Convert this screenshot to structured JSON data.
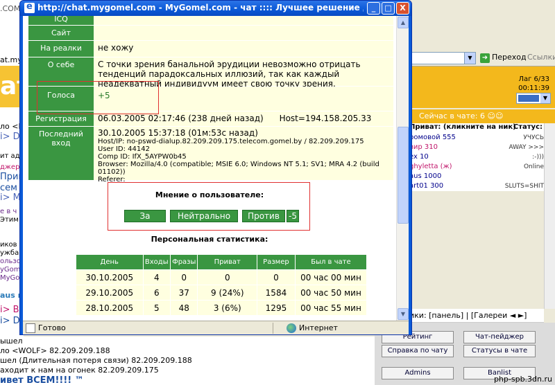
{
  "window": {
    "title": "http://chat.mygomel.com - MyGomel.com - чат :::: Лучшее решение для вашего об...",
    "minimize": "_",
    "maximize": "□",
    "close": "X"
  },
  "profile": {
    "rows": [
      {
        "label": "ICQ",
        "value": ""
      },
      {
        "label": "Сайт",
        "value": ""
      },
      {
        "label": "На реалки",
        "value": "не хожу"
      },
      {
        "label": "О себе",
        "value": "С точки зрения банальной эрудиции невозможно отрицать тенденций парадоксальных иллюзий, так как каждый неадекватный индивидуум имеет свою точку зрения."
      },
      {
        "label": "Голоса",
        "value": "+5"
      },
      {
        "label": "Регистрация",
        "value": "06.03.2005 02:17:46 (238 дней назад)      Host=194.158.205.33"
      }
    ],
    "last_login": {
      "label": "Последний вход",
      "datetime": "30.10.2005 15:37:18 (01м:53с назад)",
      "host": "Host/IP:  no-pswd-dialup.82.209.209.175.telecom.gomel.by / 82.209.209.175",
      "user_id": "User ID:  44142",
      "comp_id": "Comp ID: IfX_5AYPW0b45",
      "browser": "Browser:  Mozilla/4.0 (compatible; MSIE 6.0; Windows NT 5.1; SV1; MRA 4.2 (build 01102))",
      "referer": "Referer:"
    }
  },
  "opinion": {
    "title": "Мнение о пользователе:",
    "for_label": "За",
    "neutral_label": "Нейтрально",
    "against_label": "Против",
    "score": "-5"
  },
  "stats": {
    "title": "Персональная статистика:",
    "headers": [
      "День",
      "Входы",
      "Фразы",
      "Приват",
      "Размер",
      "Был в чате"
    ],
    "rows": [
      [
        "30.10.2005",
        "4",
        "0",
        "0",
        "0",
        "00 час 00 мин"
      ],
      [
        "29.10.2005",
        "6",
        "37",
        "9 (24%)",
        "1584",
        "00 час 50 мин"
      ],
      [
        "28.10.2005",
        "5",
        "48",
        "3 (6%)",
        "1295",
        "00 час 55 мин"
      ]
    ]
  },
  "statusbar": {
    "text": "Готово",
    "zone": "Интернет"
  },
  "background": {
    "go_label": "Переход",
    "links_label": "Ссылки",
    "lag": "Лаг 6/33",
    "time": "00:11:39",
    "online": "Сейчас в чате: 6",
    "private_header": "Приват: (кликните на ник)",
    "status_header": "Статус:",
    "users": [
      {
        "name": "ромовой 555",
        "status": "УЧУСЬ"
      },
      {
        "name": "вир 310",
        "status": "AWAY >>>"
      },
      {
        "name": "ex 10",
        "status": ":-)))"
      },
      {
        "name": "ghyletta (ж)",
        "status": "Online"
      },
      {
        "name": "aus 1000",
        "status": ""
      },
      {
        "name": "art01 300",
        "status": "SLUTS=SHIT"
      }
    ],
    "panel_text": "ики: [панель] | [Галереи ◄ ►]",
    "buttons": [
      "Рейтинг",
      "Чат-пейджер",
      "Справка по чату",
      "Статусы в чате",
      "Admins",
      "Banlist"
    ],
    "left_fragments": [
      ".COM",
      "at.mygomel.",
      "ат.",
      "ло <Dg",
      "i> Dg",
      "ит адм",
      "джере",
      "Приве",
      "сем п",
      "i> Ma",
      "е в ч",
      "Этим",
      "иков",
      "ужба",
      "ользо",
      "yGom",
      "MyGo",
      "aus в",
      "i> Bc",
      "i> Dg"
    ],
    "log": [
      "ышел",
      "ло <WOLF> 82.209.209.188",
      "шел (Длительная потеря связи) 82.209.209.188",
      "аходит к нам на огонек 82.209.209.175",
      "ивет ВСЕМ!!!! ™"
    ],
    "watermark": "php-spb.3dn.ru"
  }
}
